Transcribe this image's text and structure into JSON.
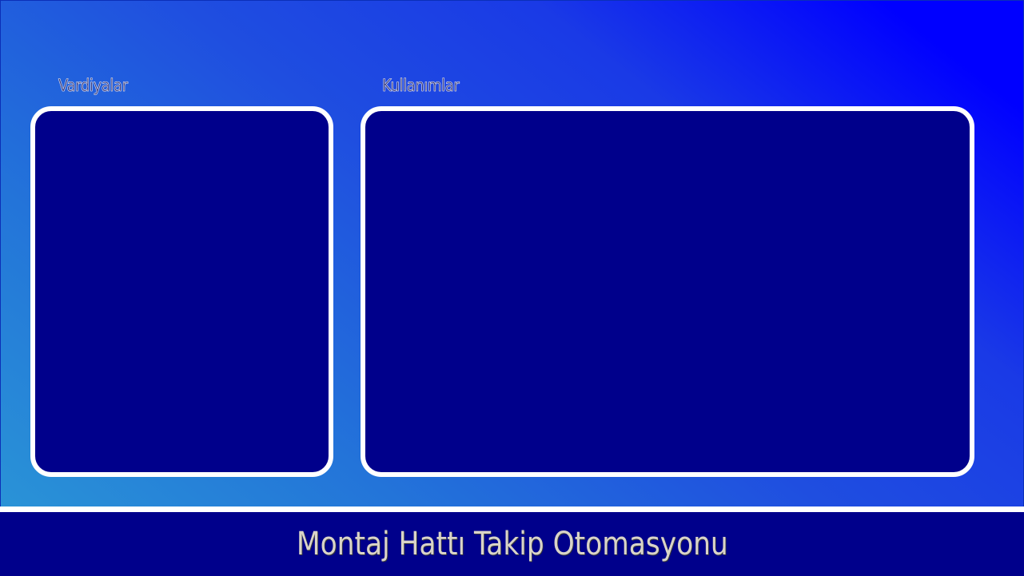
{
  "sections": {
    "shifts": {
      "label": "Vardiyalar"
    },
    "usages": {
      "label": "Kullanımlar"
    }
  },
  "footer": {
    "title": "Montaj Hattı Takip Otomasyonu"
  },
  "colors": {
    "panel_fill": "#00008b",
    "panel_border": "#ffffff",
    "footer_bg": "#00008b",
    "background_gradient_start": "#2b9ad6",
    "background_gradient_end": "#0000ff",
    "footer_text": "#d9d4c8"
  }
}
